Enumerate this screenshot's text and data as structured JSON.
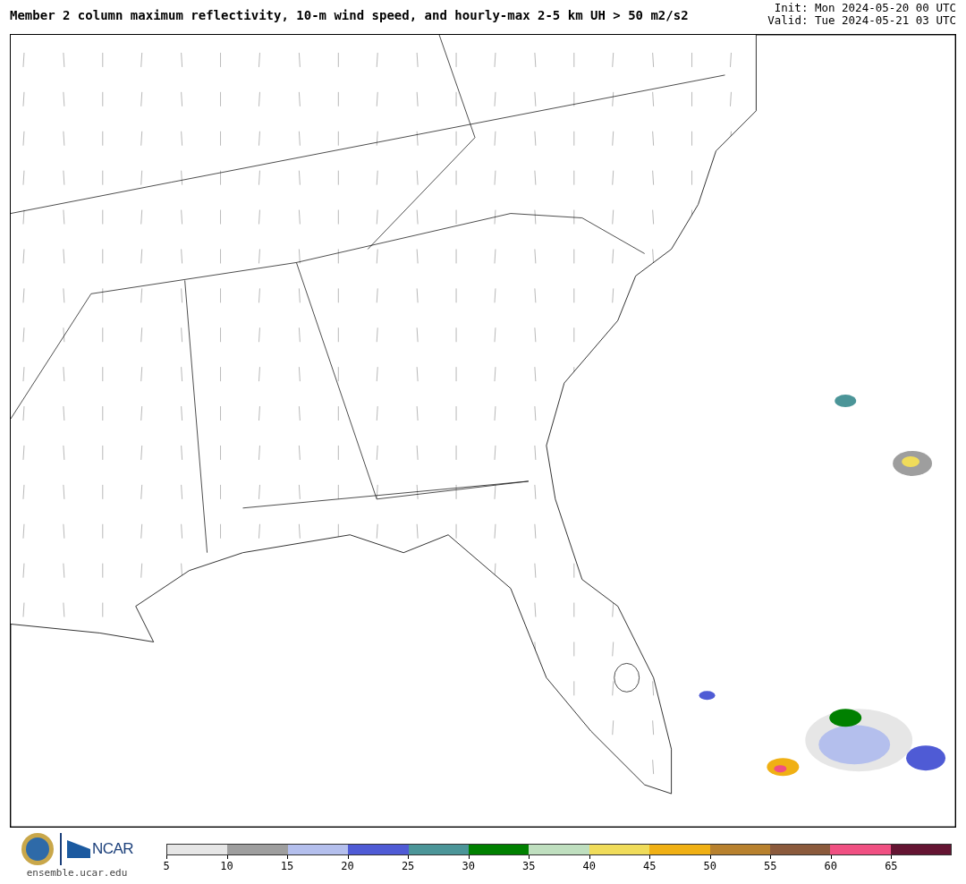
{
  "title": "Member 2 column maximum reflectivity, 10-m wind speed, and hourly-max 2-5 km UH > 50 m2/s2",
  "init": "Init: Mon 2024-05-20 00 UTC",
  "valid": "Valid: Tue 2024-05-21 03 UTC",
  "logo": {
    "org": "NCAR",
    "site": "ensemble.ucar.edu"
  },
  "colorbar": {
    "bins": [
      {
        "label": "5",
        "color": "#e6e6e6"
      },
      {
        "label": "10",
        "color": "#9e9e9e"
      },
      {
        "label": "15",
        "color": "#b4bfed"
      },
      {
        "label": "20",
        "color": "#4f5bd5"
      },
      {
        "label": "25",
        "color": "#4b9598"
      },
      {
        "label": "30",
        "color": "#008000"
      },
      {
        "label": "35",
        "color": "#bfdfbf"
      },
      {
        "label": "40",
        "color": "#f0dc5a"
      },
      {
        "label": "45",
        "color": "#f0b014"
      },
      {
        "label": "50",
        "color": "#b8812e"
      },
      {
        "label": "55",
        "color": "#8b5a3c"
      },
      {
        "label": "60",
        "color": "#f05082"
      },
      {
        "label": "65",
        "color": "#641432"
      }
    ]
  }
}
